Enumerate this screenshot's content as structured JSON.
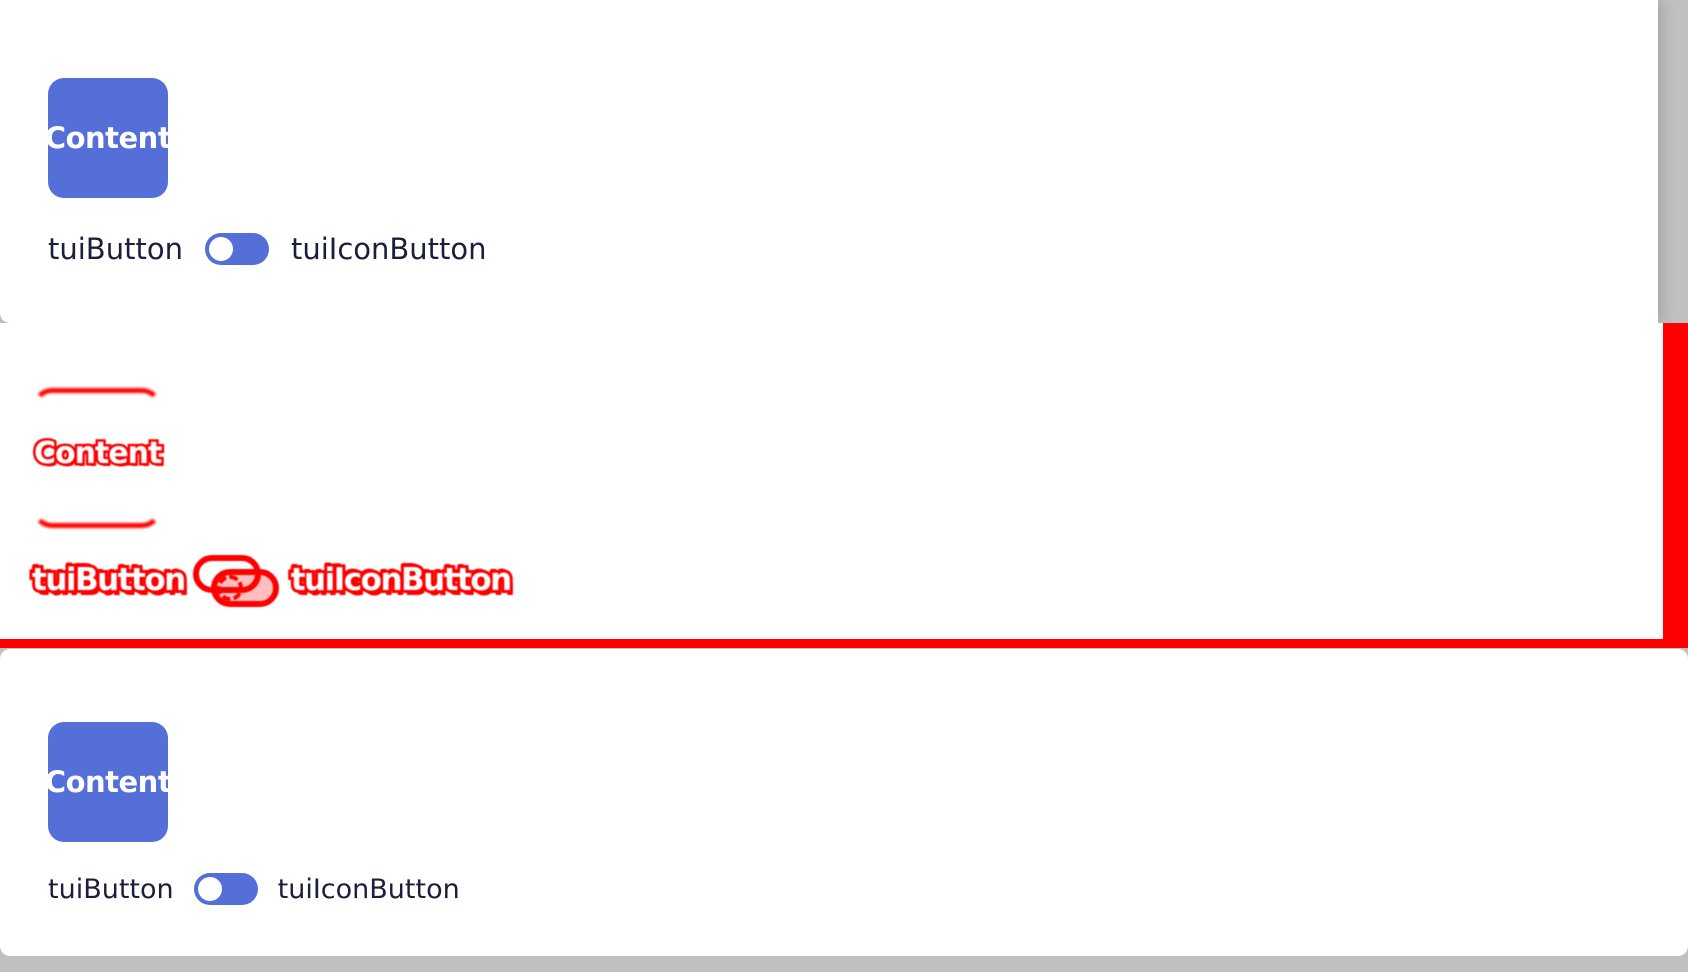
{
  "panels": {
    "top": {
      "button_label": "Content",
      "left_label": "tuiButton",
      "right_label": "tuiIconButton"
    },
    "diff": {
      "button_label": "Content",
      "left_label": "tuiButton",
      "right_label": "tuiIconButton"
    },
    "bottom": {
      "button_label": "Content",
      "left_label": "tuiButton",
      "right_label": "tuiIconButton"
    }
  },
  "colors": {
    "accent": "#5470d8",
    "diff": "#ff0000",
    "text": "#1b1f3b",
    "background": "#c0c0c0"
  },
  "toggle_state": false
}
